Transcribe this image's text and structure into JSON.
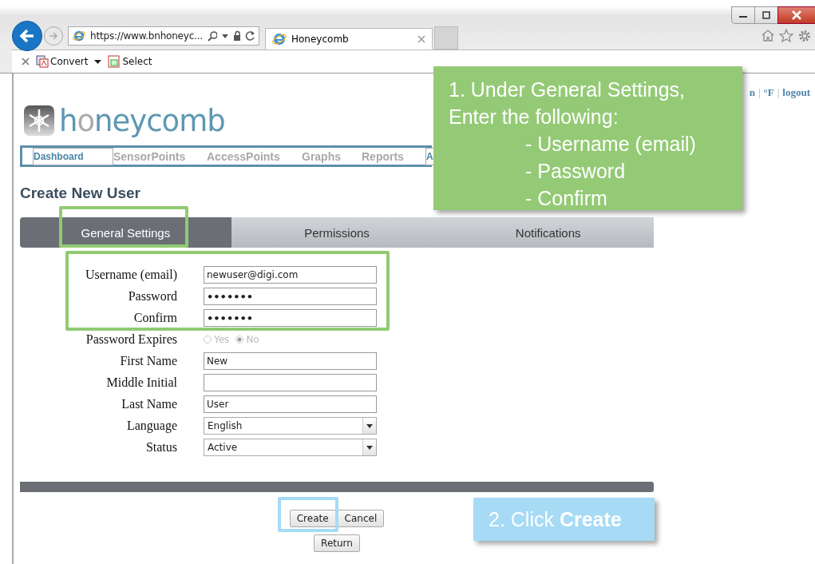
{
  "browser": {
    "address": "https://www.bnhoneyc...",
    "tab_title": "Honeycomb",
    "toolbar": [
      {
        "kind": "pdf",
        "label": "Convert",
        "dropdown": true
      },
      {
        "kind": "select",
        "label": "Select",
        "dropdown": false
      }
    ]
  },
  "header_links": [
    {
      "kind": "link",
      "text": "n"
    },
    {
      "kind": "separator",
      "text": "|"
    },
    {
      "kind": "link",
      "text": "°F"
    },
    {
      "kind": "separator",
      "text": "|"
    },
    {
      "kind": "link",
      "text": "logout"
    }
  ],
  "logo": "honeycomb",
  "nav": [
    {
      "label": "Dashboard",
      "selected": true
    },
    {
      "label": "SensorPoints",
      "selected": false
    },
    {
      "label": "AccessPoints",
      "selected": false
    },
    {
      "label": "Graphs",
      "selected": false
    },
    {
      "label": "Reports",
      "selected": false
    },
    {
      "label": "A",
      "selected": true
    }
  ],
  "title": "Create New User",
  "tabs": [
    {
      "label": "General Settings",
      "selected": true
    },
    {
      "label": "Permissions",
      "selected": false
    },
    {
      "label": "Notifications",
      "selected": false
    }
  ],
  "fields": [
    {
      "kind": "text",
      "label": "Username (email)",
      "value": "newuser@digi.com"
    },
    {
      "kind": "password",
      "label": "Password",
      "value": "•••••••"
    },
    {
      "kind": "password",
      "label": "Confirm",
      "value": "•••••••"
    },
    {
      "kind": "radio",
      "label": "Password Expires",
      "disabled": true,
      "options": [
        {
          "label": "Yes",
          "selected": false
        },
        {
          "label": "No",
          "selected": true
        }
      ]
    },
    {
      "kind": "text",
      "label": "First Name",
      "value": "New"
    },
    {
      "kind": "text",
      "label": "Middle Initial"
    },
    {
      "kind": "text",
      "label": "Last Name",
      "value": "User"
    },
    {
      "kind": "select",
      "label": "Language",
      "value": "English"
    },
    {
      "kind": "select",
      "label": "Status",
      "value": "Active"
    }
  ],
  "buttons": [
    [
      "Create",
      "Cancel"
    ],
    [
      "Return"
    ]
  ],
  "callout_1": [
    {
      "kind": "line",
      "text": "1. Under General Settings,"
    },
    {
      "kind": "line",
      "text": "Enter the following:"
    },
    {
      "kind": "bullet",
      "text": "- Username (email)"
    },
    {
      "kind": "bullet",
      "text": "- Password"
    },
    {
      "kind": "bullet",
      "text": "- Confirm"
    }
  ],
  "callout_2": "2. Click **Create**"
}
